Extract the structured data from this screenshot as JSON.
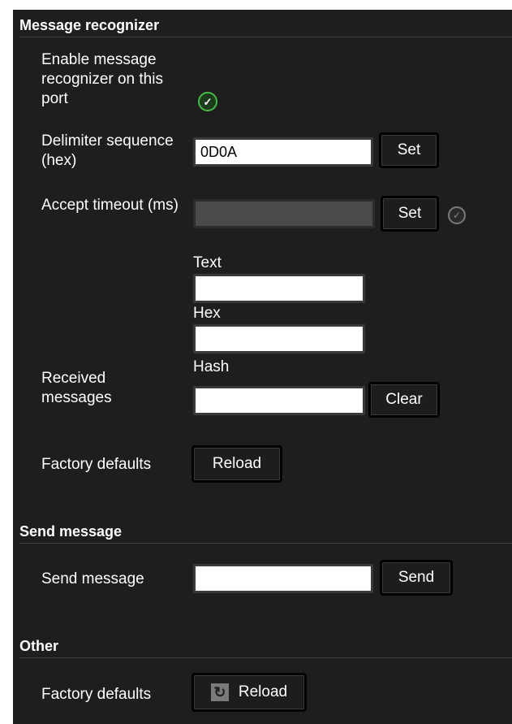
{
  "sections": {
    "recognizer": {
      "title": "Message recognizer"
    },
    "send": {
      "title": "Send message"
    },
    "other": {
      "title": "Other"
    }
  },
  "recognizer": {
    "enable_label": "Enable message recognizer on this port",
    "enable_checked": true,
    "delimiter_label": "Delimiter sequence (hex)",
    "delimiter_value": "0D0A",
    "delimiter_set": "Set",
    "timeout_label": "Accept timeout (ms)",
    "timeout_value": "",
    "timeout_set": "Set",
    "timeout_enabled": false,
    "received_label": "Received messages",
    "text_label": "Text",
    "text_value": "",
    "hex_label": "Hex",
    "hex_value": "",
    "hash_label": "Hash",
    "hash_value": "",
    "clear_label": "Clear",
    "factory_label": "Factory defaults",
    "reload_label": "Reload"
  },
  "send": {
    "label": "Send message",
    "value": "",
    "button": "Send"
  },
  "other": {
    "factory_label": "Factory defaults",
    "reload_label": "Reload",
    "reload_icon": "refresh-icon"
  },
  "colors": {
    "panel_bg": "#1e1e1e",
    "check_green": "#48b848"
  }
}
